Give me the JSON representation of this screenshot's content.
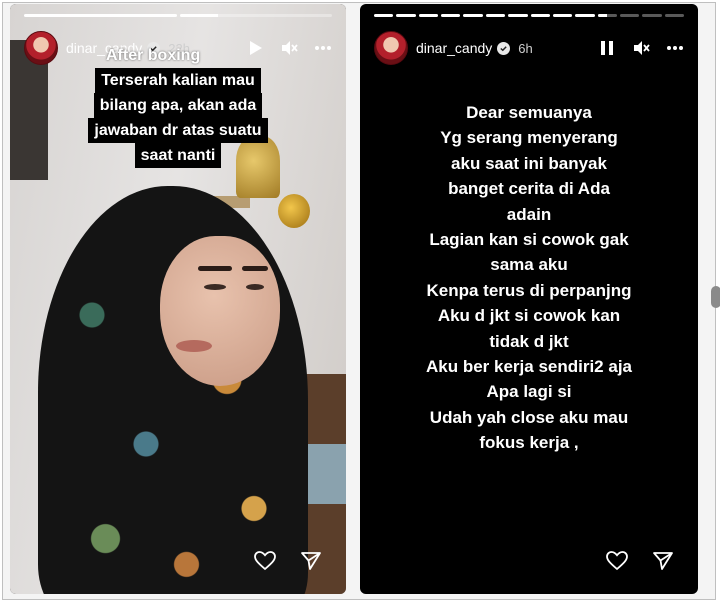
{
  "stories": [
    {
      "progress": [
        1,
        0.25
      ],
      "username": "dinar_candy",
      "time": "22h",
      "background_text": "After boxing",
      "caption_lines": [
        "Terserah kalian mau",
        "bilang apa, akan ada",
        "jawaban dr atas suatu",
        "saat nanti"
      ],
      "controls": [
        "play-icon",
        "mute-icon",
        "more-icon"
      ],
      "footer": [
        "heart-icon",
        "send-icon"
      ]
    },
    {
      "progress": [
        1,
        1,
        1,
        1,
        1,
        1,
        1,
        1,
        1,
        1,
        0.5,
        0,
        0,
        0
      ],
      "username": "dinar_candy",
      "time": "6h",
      "text_lines": [
        "Dear semuanya",
        "Yg serang menyerang",
        "aku saat ini banyak",
        "banget cerita di Ada",
        "adain",
        "Lagian kan si cowok gak",
        "sama aku",
        "Kenpa terus di perpanjng",
        "Aku d jkt si cowok kan",
        "tidak d jkt",
        "Aku ber kerja sendiri2 aja",
        "Apa lagi si",
        "Udah yah close aku mau",
        "fokus kerja ,"
      ],
      "controls": [
        "pause-icon",
        "mute-icon",
        "more-icon"
      ],
      "footer": [
        "heart-icon",
        "send-icon"
      ]
    }
  ],
  "colors": {
    "story_bg": "#000000",
    "text": "#ffffff",
    "caption_bg": "#000000"
  }
}
